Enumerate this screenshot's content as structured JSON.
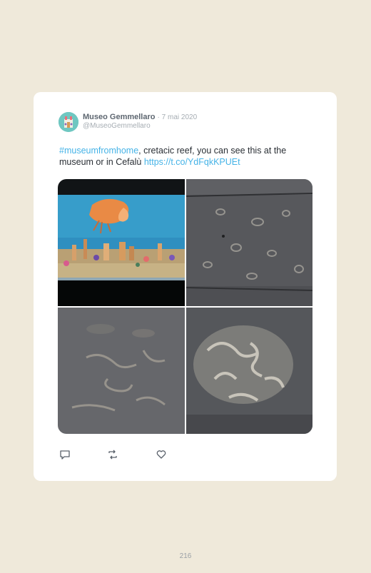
{
  "tweet": {
    "author_name": "Museo Gemmellaro",
    "date": "· 7 mai 2020",
    "handle": "@MuseoGemmellaro",
    "hashtag": "#museumfromhome",
    "text": ", cretacic reef, you can see this at the museum or in Cefalù ",
    "link": "https://t.co/YdFqkKPUEt"
  },
  "media": [
    {
      "icon": "aquarium-reef-diorama-photo"
    },
    {
      "icon": "fossil-rock-slab-photo"
    },
    {
      "icon": "fossil-stone-surface-photo"
    },
    {
      "icon": "fossil-rudist-closeup-photo"
    }
  ],
  "actions": [
    {
      "icon": "reply-icon"
    },
    {
      "icon": "retweet-icon"
    },
    {
      "icon": "like-icon"
    }
  ],
  "colors": {
    "background": "#efe9da",
    "card": "#ffffff",
    "link": "#45b3e7"
  },
  "page_number": "216"
}
